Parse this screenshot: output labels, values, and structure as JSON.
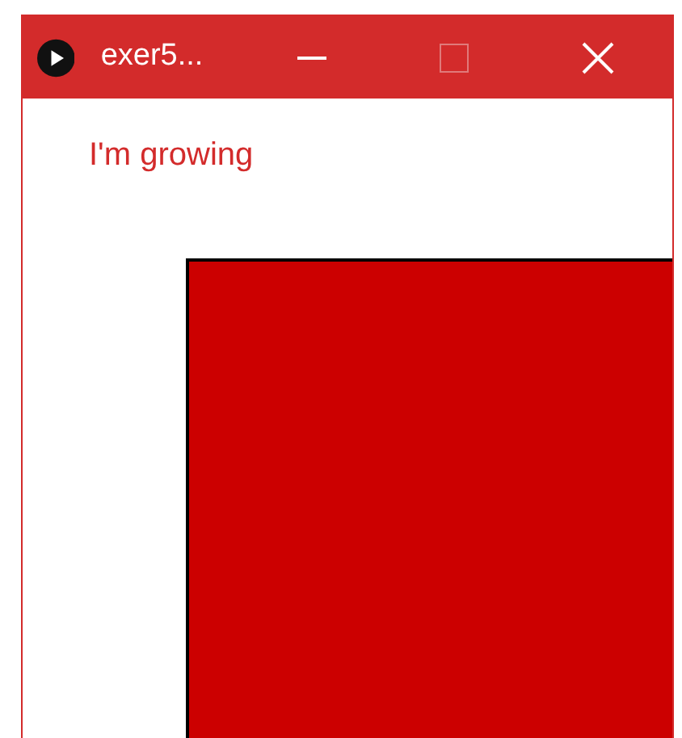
{
  "window": {
    "title": "exer5...",
    "maximize": {
      "disabled": true
    }
  },
  "content": {
    "label": "I'm growing"
  }
}
